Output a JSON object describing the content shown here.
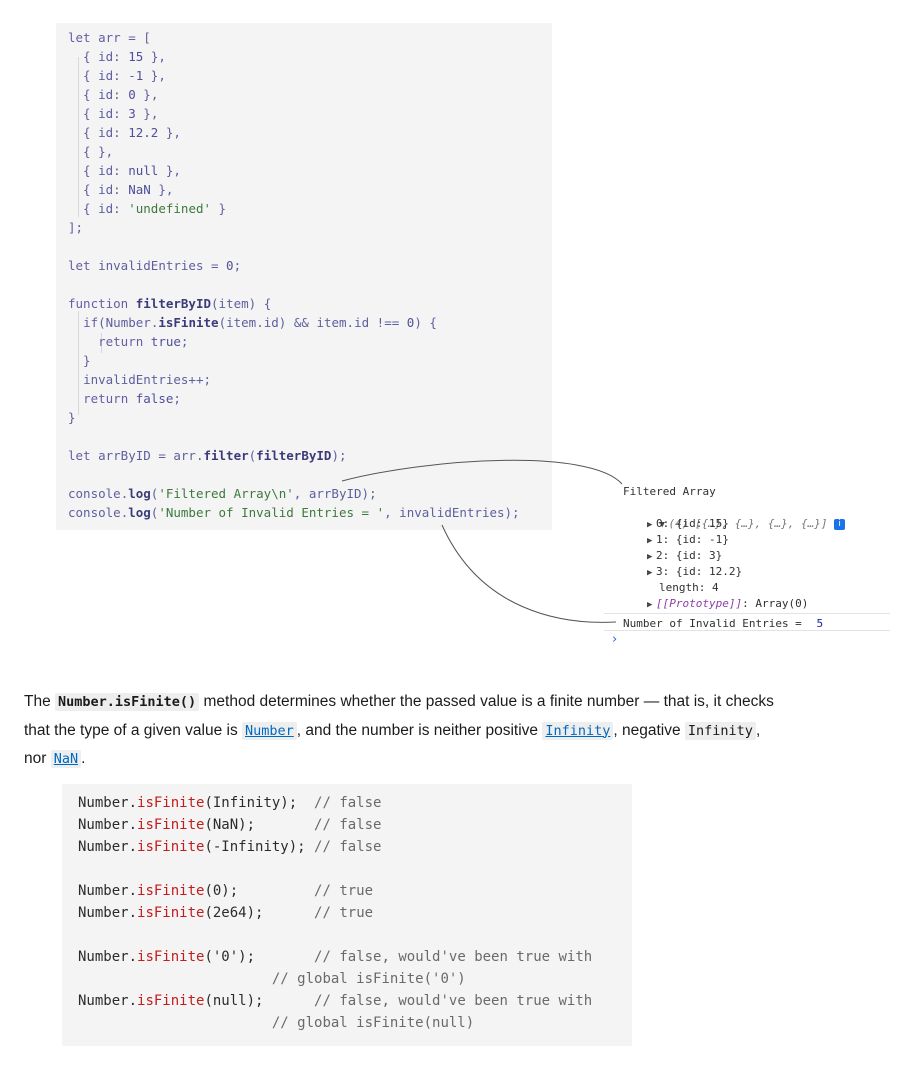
{
  "code1": {
    "lines": [
      "let arr = [",
      "  { id: 15 },",
      "  { id: -1 },",
      "  { id: 0 },",
      "  { id: 3 },",
      "  { id: 12.2 },",
      "  { },",
      "  { id: null },",
      "  { id: NaN },",
      "  { id: 'undefined' }",
      "];",
      "",
      "let invalidEntries = 0;",
      "",
      "function filterByID(item) {",
      "  if(Number.isFinite(item.id) && item.id !== 0) {",
      "    return true;",
      "  }",
      "  invalidEntries++;",
      "  return false;",
      "}",
      "",
      "let arrByID = arr.filter(filterByID);",
      "",
      "console.log('Filtered Array\\n', arrByID);",
      "console.log('Number of Invalid Entries = ', invalidEntries);"
    ]
  },
  "console": {
    "header": "Filtered Array",
    "summary": "(4) [{…}, {…}, {…}, {…}]",
    "items": [
      "0: {id: 15}",
      "1: {id: -1}",
      "2: {id: 3}",
      "3: {id: 12.2}"
    ],
    "length_label": "length: 4",
    "prototype_key": "[[Prototype]]",
    "prototype_value": ": Array(0)",
    "invalid_label": "Number of Invalid Entries = ",
    "invalid_value": "5",
    "prompt": "›",
    "info": "i"
  },
  "paragraph": {
    "t1": "The ",
    "code_method": "Number.isFinite()",
    "t2": " method determines whether the passed value is a finite number — that is, it checks that the type of a given value is ",
    "link_number": "Number",
    "t3": ", and the number is neither positive ",
    "link_infinity": "Infinity",
    "t4": ", negative ",
    "code_infinity": "Infinity",
    "t5": ", nor ",
    "link_nan": "NaN",
    "t6": "."
  },
  "code2": {
    "lines": [
      {
        "obj": "Number.",
        "m": "isFinite",
        "args": "(Infinity);",
        "pad": "  ",
        "comment": "// false"
      },
      {
        "obj": "Number.",
        "m": "isFinite",
        "args": "(NaN);",
        "pad": "       ",
        "comment": "// false"
      },
      {
        "obj": "Number.",
        "m": "isFinite",
        "args": "(-Infinity);",
        "pad": " ",
        "comment": "// false"
      },
      null,
      {
        "obj": "Number.",
        "m": "isFinite",
        "args": "(0);",
        "pad": "         ",
        "comment": "// true"
      },
      {
        "obj": "Number.",
        "m": "isFinite",
        "args": "(2e64);",
        "pad": "      ",
        "comment": "// true"
      },
      null,
      {
        "obj": "Number.",
        "m": "isFinite",
        "args": "('0');",
        "pad": "       ",
        "comment": "// false, would've been true with"
      },
      {
        "cont": "// global isFinite('0')"
      },
      {
        "obj": "Number.",
        "m": "isFinite",
        "args": "(null);",
        "pad": "      ",
        "comment": "// false, would've been true with"
      },
      {
        "cont": "// global isFinite(null)"
      }
    ]
  }
}
